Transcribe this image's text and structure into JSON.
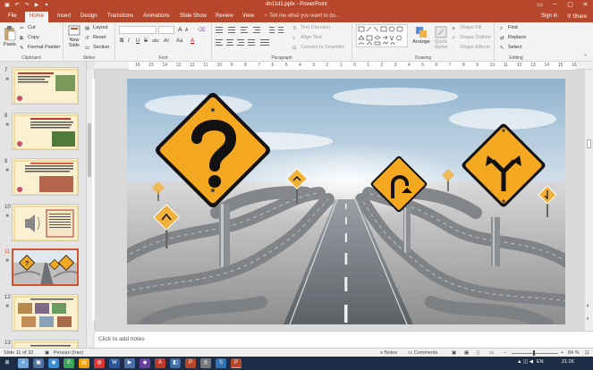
{
  "window": {
    "title": "dn11d1.pptx - PowerPoint"
  },
  "quick_access": {
    "icons": [
      "save-icon",
      "undo-icon",
      "redo-icon",
      "present-icon",
      "customize-icon"
    ]
  },
  "window_controls": {
    "ribbon_options": "▭",
    "minimize": "–",
    "maximize": "▢",
    "close": "✕"
  },
  "tabs": [
    "File",
    "Home",
    "Insert",
    "Design",
    "Transitions",
    "Animations",
    "Slide Show",
    "Review",
    "View"
  ],
  "active_tab": "Home",
  "tell_me": "Tell me what you want to do...",
  "account": {
    "signin": "Sign in",
    "share": "Share"
  },
  "ribbon": {
    "clipboard": {
      "label": "Clipboard",
      "paste": "Paste",
      "cut": "Cut",
      "copy": "Copy",
      "format_painter": "Format Painter"
    },
    "slides": {
      "label": "Slides",
      "new_slide": "New",
      "new_slide2": "Slide",
      "layout": "Layout",
      "reset": "Reset",
      "section": "Section"
    },
    "font": {
      "label": "Font",
      "bold": "B",
      "italic": "I",
      "underline": "U",
      "strike": "S",
      "shadow": "abc",
      "spacing": "AV",
      "case": "Aa",
      "grow": "A",
      "shrink": "A",
      "color": "A"
    },
    "paragraph": {
      "label": "Paragraph",
      "text_direction": "Text Direction",
      "align_text": "Align Text",
      "smartart": "Convert to SmartArt"
    },
    "drawing": {
      "label": "Drawing",
      "arrange": "Arrange",
      "quick_styles": "Quick",
      "quick_styles2": "Styles",
      "shape_fill": "Shape Fill",
      "shape_outline": "Shape Outline",
      "shape_effects": "Shape Effects"
    },
    "editing": {
      "label": "Editing",
      "find": "Find",
      "replace": "Replace",
      "select": "Select"
    }
  },
  "ruler_h": [
    "16",
    "15",
    "14",
    "13",
    "12",
    "11",
    "10",
    "9",
    "8",
    "7",
    "6",
    "5",
    "4",
    "3",
    "2",
    "1",
    "0",
    "1",
    "2",
    "3",
    "4",
    "5",
    "6",
    "7",
    "8",
    "9",
    "10",
    "11",
    "12",
    "13",
    "14",
    "15",
    "16"
  ],
  "thumbnails": [
    {
      "num": "7",
      "selected": false,
      "theme": "text-photo"
    },
    {
      "num": "8",
      "selected": false,
      "theme": "text-photo"
    },
    {
      "num": "9",
      "selected": false,
      "theme": "text-photo"
    },
    {
      "num": "10",
      "selected": false,
      "theme": "speaker-text"
    },
    {
      "num": "11",
      "selected": true,
      "theme": "road-signs"
    },
    {
      "num": "12",
      "selected": false,
      "theme": "photo-grid"
    },
    {
      "num": "13",
      "selected": false,
      "theme": "text-photo"
    }
  ],
  "notes_placeholder": "Click to add notes",
  "status": {
    "slide": "Slide 11 of 32",
    "language": "Persian (Iran)",
    "notes": "Notes",
    "comments": "Comments",
    "zoom": "84 %"
  },
  "taskbar": {
    "lang": "EN",
    "time": "21:26"
  },
  "colors": {
    "accent": "#b7472a",
    "sign_yellow": "#f4a820",
    "sign_black": "#111111"
  }
}
